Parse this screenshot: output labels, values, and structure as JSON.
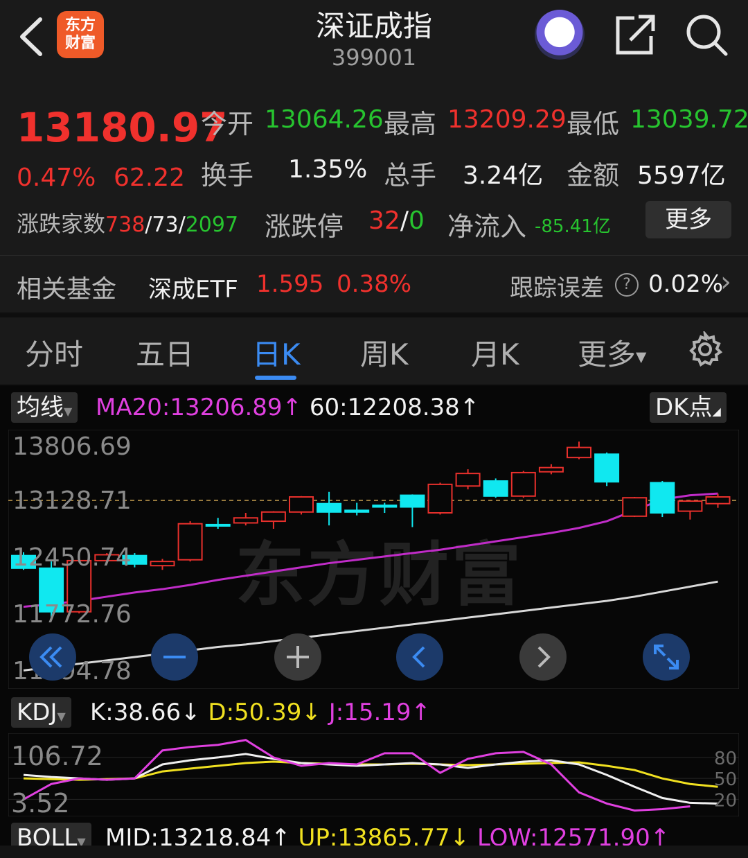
{
  "header": {
    "title": "深证成指",
    "code": "399001",
    "logo_line1": "东方",
    "logo_line2": "财富"
  },
  "quote": {
    "price": "13180.97",
    "change_pct": "0.47%",
    "change": "62.22",
    "open_label": "今开",
    "open": "13064.26",
    "high_label": "最高",
    "high": "13209.29",
    "low_label": "最低",
    "low": "13039.72",
    "turnover_label": "换手",
    "turnover": "1.35%",
    "volume_label": "总手",
    "volume": "3.24亿",
    "amount_label": "金额",
    "amount": "5597亿",
    "breadth_label": "涨跌家数",
    "breadth_up": "738",
    "breadth_flat": "73",
    "breadth_down": "2097",
    "slash": "/",
    "limit_label": "涨跌停",
    "limit_up": "32",
    "limit_down": "0",
    "netflow_label": "净流入",
    "netflow": "-85.41亿",
    "more_label": "更多"
  },
  "fund": {
    "label": "相关基金",
    "name": "深成ETF",
    "price": "1.595",
    "pct": "0.38%",
    "tracking_label": "跟踪误差",
    "help_icon": "?",
    "tracking_value": "0.02%",
    "chevron": "›"
  },
  "tabs": [
    {
      "label": "分时"
    },
    {
      "label": "五日"
    },
    {
      "label": "日K"
    },
    {
      "label": "周K"
    },
    {
      "label": "月K"
    },
    {
      "label": "更多"
    }
  ],
  "active_tab": "日K",
  "ma_bar": {
    "button": "均线",
    "ma20": "MA20:13206.89",
    "ma60": "60:12208.38",
    "dk_button": "DK点"
  },
  "kdj_bar": {
    "button": "KDJ",
    "k": "K:38.66",
    "d": "D:50.39",
    "j": "J:15.19"
  },
  "boll_bar": {
    "button": "BOLL",
    "mid": "MID:13218.84",
    "up": "UP:13865.77",
    "low": "LOW:12571.90"
  },
  "watermark": "东方财富",
  "chart_data": {
    "type": "candlestick",
    "y_labels": [
      "13806.69",
      "13128.71",
      "12450.74",
      "11772.76",
      "11094.78"
    ],
    "ylim": [
      11094.78,
      13806.69
    ],
    "reference_price": 13128.71,
    "candles": [
      {
        "o": 12470,
        "c": 12320,
        "h": 12510,
        "l": 12300
      },
      {
        "o": 12320,
        "c": 11800,
        "h": 12400,
        "l": 11700
      },
      {
        "o": 11800,
        "c": 12410,
        "h": 12480,
        "l": 11780
      },
      {
        "o": 12410,
        "c": 12480,
        "h": 12500,
        "l": 12380
      },
      {
        "o": 12470,
        "c": 12370,
        "h": 12500,
        "l": 12330
      },
      {
        "o": 12350,
        "c": 12400,
        "h": 12430,
        "l": 12300
      },
      {
        "o": 12420,
        "c": 12850,
        "h": 12880,
        "l": 12400
      },
      {
        "o": 12840,
        "c": 12830,
        "h": 12920,
        "l": 12790
      },
      {
        "o": 12860,
        "c": 12920,
        "h": 12980,
        "l": 12830
      },
      {
        "o": 12880,
        "c": 12990,
        "h": 13000,
        "l": 12790
      },
      {
        "o": 12990,
        "c": 13170,
        "h": 13180,
        "l": 12960
      },
      {
        "o": 13090,
        "c": 12990,
        "h": 13230,
        "l": 12830
      },
      {
        "o": 13010,
        "c": 12990,
        "h": 13100,
        "l": 12950
      },
      {
        "o": 13070,
        "c": 13050,
        "h": 13100,
        "l": 12980
      },
      {
        "o": 13190,
        "c": 13050,
        "h": 13200,
        "l": 12810
      },
      {
        "o": 12980,
        "c": 13320,
        "h": 13340,
        "l": 12960
      },
      {
        "o": 13300,
        "c": 13450,
        "h": 13500,
        "l": 13260
      },
      {
        "o": 13360,
        "c": 13180,
        "h": 13390,
        "l": 13160
      },
      {
        "o": 13180,
        "c": 13460,
        "h": 13480,
        "l": 13160
      },
      {
        "o": 13470,
        "c": 13520,
        "h": 13560,
        "l": 13440
      },
      {
        "o": 13640,
        "c": 13760,
        "h": 13830,
        "l": 13620
      },
      {
        "o": 13680,
        "c": 13350,
        "h": 13700,
        "l": 13300
      },
      {
        "o": 12940,
        "c": 13160,
        "h": 13170,
        "l": 12930
      },
      {
        "o": 13340,
        "c": 12980,
        "h": 13360,
        "l": 12930
      },
      {
        "o": 13000,
        "c": 13120,
        "h": 13130,
        "l": 12900
      },
      {
        "o": 13090,
        "c": 13170,
        "h": 13209,
        "l": 13040
      }
    ],
    "ma20": [
      11860,
      11890,
      11930,
      11980,
      12030,
      12070,
      12120,
      12180,
      12230,
      12280,
      12330,
      12380,
      12420,
      12460,
      12500,
      12540,
      12590,
      12640,
      12690,
      12740,
      12800,
      12880,
      13010,
      13140,
      13190,
      13210
    ],
    "ma60": [
      11100,
      11140,
      11180,
      11220,
      11260,
      11300,
      11340,
      11380,
      11410,
      11450,
      11490,
      11530,
      11570,
      11610,
      11650,
      11690,
      11730,
      11770,
      11810,
      11850,
      11890,
      11930,
      11980,
      12040,
      12100,
      12160
    ],
    "kdj": {
      "levels": [
        "80",
        "50",
        "20"
      ],
      "y_labels": [
        "106.72",
        "3.52"
      ],
      "ylim": [
        3.52,
        106.72
      ],
      "K": [
        55,
        52,
        50,
        48,
        50,
        70,
        76,
        80,
        85,
        78,
        72,
        70,
        68,
        70,
        72,
        70,
        65,
        70,
        74,
        76,
        70,
        55,
        38,
        22,
        15,
        14
      ],
      "D": [
        50,
        49,
        48,
        49,
        50,
        60,
        64,
        68,
        72,
        74,
        72,
        71,
        70,
        70,
        71,
        70,
        69,
        70,
        71,
        72,
        73,
        68,
        62,
        50,
        42,
        38
      ],
      "J": [
        20,
        42,
        50,
        48,
        50,
        90,
        95,
        98,
        105,
        80,
        68,
        72,
        70,
        86,
        86,
        58,
        78,
        86,
        88,
        70,
        30,
        14,
        4,
        6,
        10
      ]
    }
  }
}
